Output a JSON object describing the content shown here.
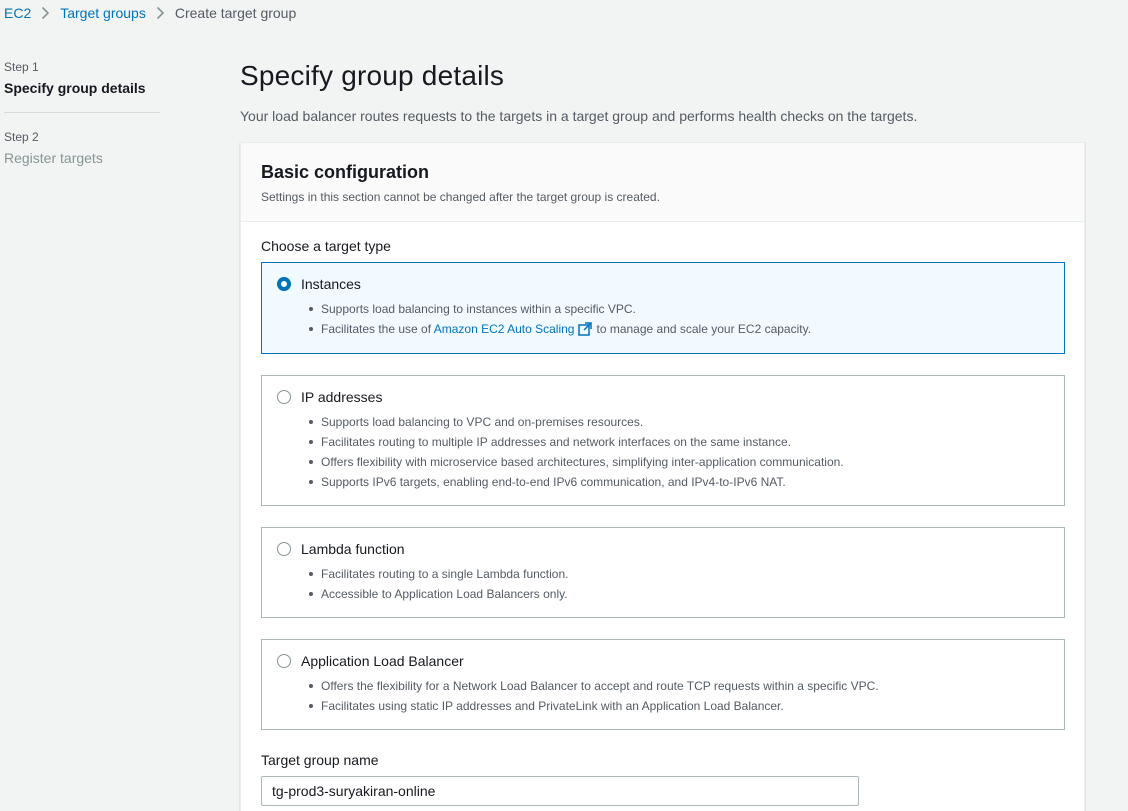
{
  "breadcrumb": {
    "items": [
      "EC2",
      "Target groups"
    ],
    "current": "Create target group"
  },
  "steps": [
    {
      "number": "Step 1",
      "title": "Specify group details",
      "active": true
    },
    {
      "number": "Step 2",
      "title": "Register targets",
      "active": false
    }
  ],
  "page": {
    "title": "Specify group details",
    "description": "Your load balancer routes requests to the targets in a target group and performs health checks on the targets."
  },
  "basic_config": {
    "title": "Basic configuration",
    "description": "Settings in this section cannot be changed after the target group is created.",
    "target_type_label": "Choose a target type",
    "options": [
      {
        "label": "Instances",
        "selected": true,
        "bullets": [
          "Supports load balancing to instances within a specific VPC."
        ],
        "bullet_with_link": {
          "prefix": "Facilitates the use of",
          "link": "Amazon EC2 Auto Scaling",
          "suffix": "to manage and scale your EC2 capacity."
        }
      },
      {
        "label": "IP addresses",
        "selected": false,
        "bullets": [
          "Supports load balancing to VPC and on-premises resources.",
          "Facilitates routing to multiple IP addresses and network interfaces on the same instance.",
          "Offers flexibility with microservice based architectures, simplifying inter-application communication.",
          "Supports IPv6 targets, enabling end-to-end IPv6 communication, and IPv4-to-IPv6 NAT."
        ]
      },
      {
        "label": "Lambda function",
        "selected": false,
        "bullets": [
          "Facilitates routing to a single Lambda function.",
          "Accessible to Application Load Balancers only."
        ]
      },
      {
        "label": "Application Load Balancer",
        "selected": false,
        "bullets": [
          "Offers the flexibility for a Network Load Balancer to accept and route TCP requests within a specific VPC.",
          "Facilitates using static IP addresses and PrivateLink with an Application Load Balancer."
        ]
      }
    ],
    "name_label": "Target group name",
    "name_value": "tg-prod3-suryakiran-online"
  },
  "colors": {
    "link": "#0073bb",
    "selected_bg": "#f1faff",
    "selected_border": "#0073bb"
  }
}
